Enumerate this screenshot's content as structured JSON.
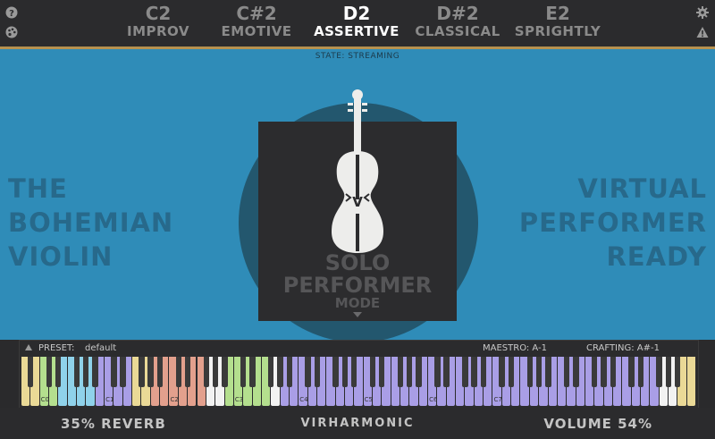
{
  "tabs": [
    {
      "note": "C2",
      "mood": "IMPROV"
    },
    {
      "note": "C#2",
      "mood": "EMOTIVE"
    },
    {
      "note": "D2",
      "mood": "ASSERTIVE",
      "active": true
    },
    {
      "note": "D#2",
      "mood": "CLASSICAL"
    },
    {
      "note": "E2",
      "mood": "SPRIGHTLY"
    }
  ],
  "icons": {
    "top_left_1": "help-icon",
    "top_left_2": "palette-icon",
    "top_right_1": "gear-icon",
    "top_right_2": "warning-icon"
  },
  "state_text": "STATE: STREAMING",
  "left_title": [
    "THE",
    "BOHEMIAN",
    "VIOLIN"
  ],
  "right_title": [
    "VIRTUAL",
    "PERFORMER",
    "READY"
  ],
  "mode": {
    "violin_letter": "V",
    "line1": "SOLO",
    "line2": "PERFORMER",
    "line3": "MODE"
  },
  "keyboard": {
    "preset_label": "PRESET:",
    "preset_value": "default",
    "maestro": "MAESTRO: A-1",
    "crafting": "CRAFTING: A#-1",
    "octave_labels": [
      "C0",
      "C1",
      "C2",
      "C3",
      "C4",
      "C5",
      "C6",
      "C7"
    ]
  },
  "bottom": {
    "reverb": "35% REVERB",
    "brand": "VIRHARMONIC",
    "volume": "VOLUME 54%"
  },
  "colors": {
    "accent_gold": "#b7924f",
    "main_blue": "#2f8cb8",
    "purple_keys": "#a99ee6",
    "green_keys": "#b4df8e",
    "cyan_keys": "#8fd2ea",
    "salmon_keys": "#e3a08d",
    "yellow_keys": "#ead996"
  }
}
